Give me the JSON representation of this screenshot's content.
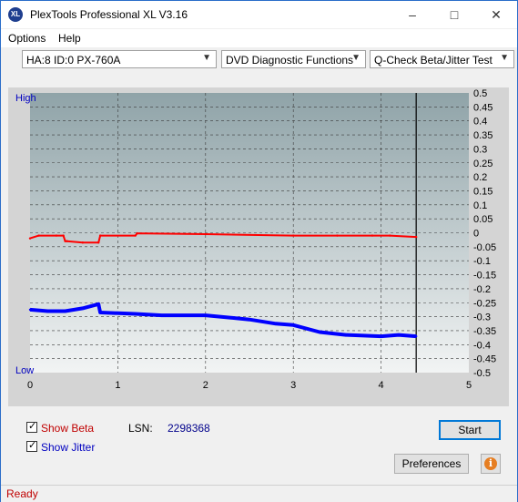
{
  "window": {
    "title": "PlexTools Professional XL V3.16",
    "icon_text": "XL"
  },
  "menu": {
    "options": "Options",
    "help": "Help"
  },
  "dropdowns": {
    "drive": "HA:8 ID:0  PX-760A",
    "function": "DVD Diagnostic Functions",
    "test": "Q-Check Beta/Jitter Test"
  },
  "chart_labels": {
    "high": "High",
    "low": "Low"
  },
  "chart_data": {
    "type": "line",
    "x_ticks": [
      "0",
      "1",
      "2",
      "3",
      "4",
      "5"
    ],
    "xlim": [
      0,
      5
    ],
    "y_ticks": [
      "0.5",
      "0.45",
      "0.4",
      "0.35",
      "0.3",
      "0.25",
      "0.2",
      "0.15",
      "0.1",
      "0.05",
      "0",
      "-0.05",
      "-0.1",
      "-0.15",
      "-0.2",
      "-0.25",
      "-0.3",
      "-0.35",
      "-0.4",
      "-0.45",
      "-0.5"
    ],
    "ylim": [
      -0.5,
      0.5
    ],
    "end_marker_x": 4.4,
    "grid": true,
    "series": [
      {
        "name": "Beta",
        "color": "#ff0000",
        "x": [
          0,
          0.1,
          0.3,
          0.38,
          0.4,
          0.42,
          0.6,
          0.78,
          0.8,
          1.2,
          1.22,
          2,
          3,
          3.5,
          3.9,
          4.1,
          4.4
        ],
        "y": [
          -0.02,
          -0.01,
          -0.01,
          -0.01,
          -0.03,
          -0.03,
          -0.035,
          -0.035,
          -0.01,
          -0.01,
          -0.002,
          -0.005,
          -0.01,
          -0.01,
          -0.01,
          -0.01,
          -0.015
        ]
      },
      {
        "name": "Jitter",
        "color": "#0000ff",
        "x": [
          0,
          0.2,
          0.4,
          0.6,
          0.78,
          0.8,
          1.2,
          1.5,
          2,
          2.5,
          2.8,
          3,
          3.3,
          3.6,
          4,
          4.2,
          4.4
        ],
        "y": [
          -0.275,
          -0.28,
          -0.28,
          -0.27,
          -0.255,
          -0.285,
          -0.29,
          -0.295,
          -0.295,
          -0.31,
          -0.325,
          -0.33,
          -0.355,
          -0.365,
          -0.37,
          -0.365,
          -0.37
        ]
      }
    ]
  },
  "controls": {
    "show_beta": "Show Beta",
    "show_jitter": "Show Jitter",
    "lsn_label": "LSN:",
    "lsn_value": "2298368",
    "start": "Start",
    "preferences": "Preferences",
    "info_icon_text": "i"
  },
  "status": {
    "text": "Ready"
  },
  "colors": {
    "beta": "#ff0000",
    "jitter": "#0000ff",
    "accent": "#0078d7"
  }
}
